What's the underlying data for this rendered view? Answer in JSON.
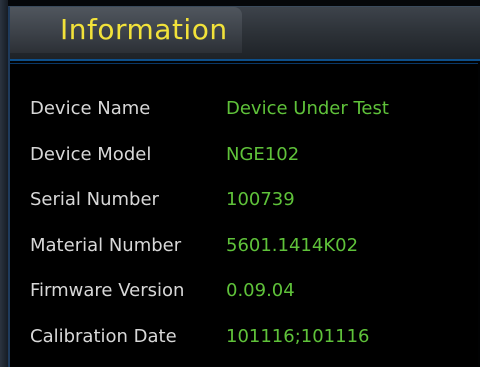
{
  "panel": {
    "title": "Information"
  },
  "info": {
    "rows": [
      {
        "label": "Device Name",
        "value": "Device Under Test"
      },
      {
        "label": "Device Model",
        "value": "NGE102"
      },
      {
        "label": "Serial Number",
        "value": "100739"
      },
      {
        "label": "Material Number",
        "value": "5601.1414K02"
      },
      {
        "label": "Firmware Version",
        "value": "0.09.04"
      },
      {
        "label": "Calibration Date",
        "value": "101116;101116"
      }
    ]
  },
  "colors": {
    "title": "#f2e23a",
    "label": "#d8d8d8",
    "value": "#5fc23a",
    "accent_border": "#0d4f8a"
  }
}
